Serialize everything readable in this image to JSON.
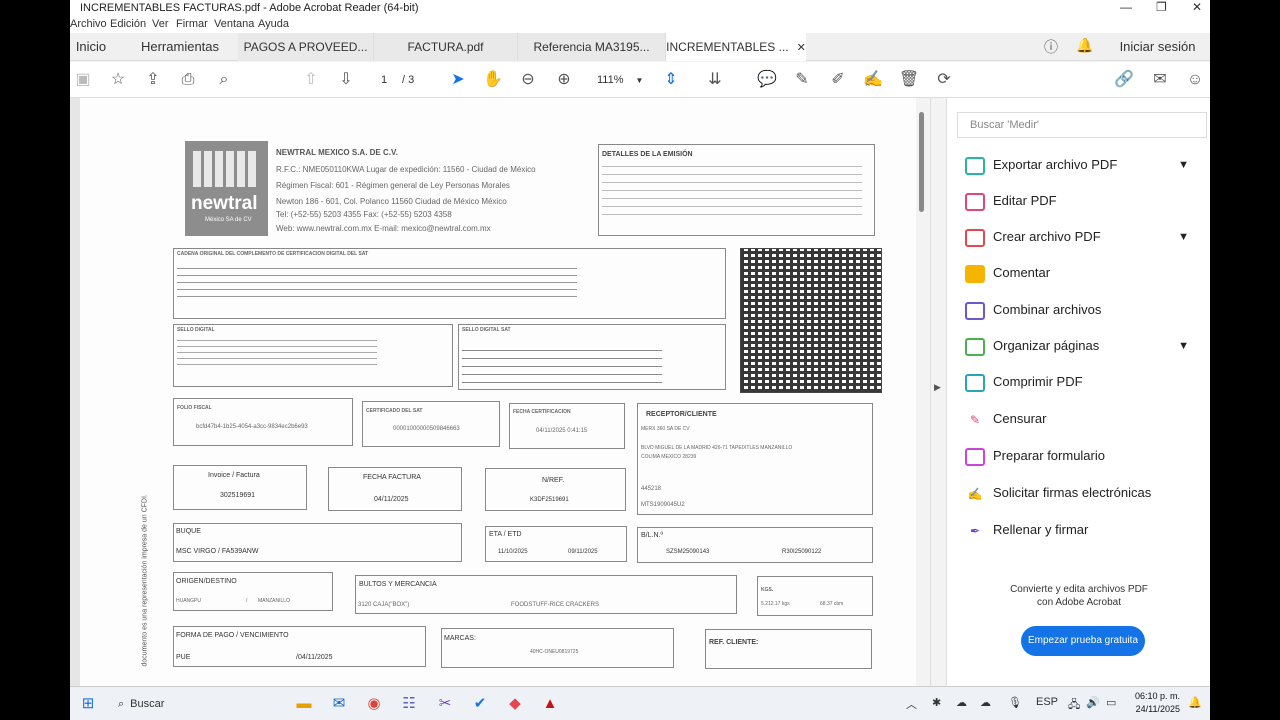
{
  "window": {
    "title": "INCREMENTABLES FACTURAS.pdf - Adobe Acrobat Reader (64-bit)"
  },
  "menu": [
    "Archivo",
    "Edición",
    "Ver",
    "Firmar",
    "Ventana",
    "Ayuda"
  ],
  "tabs": {
    "home": "Inicio",
    "tools": "Herramientas",
    "docs": [
      "PAGOS A PROVEED...",
      "FACTURA.pdf",
      "Referencia MA3195...",
      "INCREMENTABLES ..."
    ],
    "signin": "Iniciar sesión"
  },
  "toolbar": {
    "page_current": "1",
    "page_total": "/ 3",
    "zoom": "111%"
  },
  "invoice": {
    "company": "NEWTRAL MEXICO S.A. DE C.V.",
    "rfc": "R.F.C.: NME050110KWA   Lugar de expedición: 11560 - Ciudad de México",
    "regimen": "Régimen Fiscal: 601 - Régimen general de Ley Personas Morales",
    "address": "Newton 186 - 601, Col. Polanco 11560 Ciudad de México   México",
    "phone": "Tel: (+52-55) 5203 4355 Fax: (+52-55) 5203 4358",
    "web": "Web: www.newtral.com.mx      E-mail: mexico@newtral.com.mx",
    "logo_text": "newtral",
    "logo_sub": "México SA de CV",
    "detalles_title": "DETALLES DE LA EMISIÓN",
    "cadena_title": "CADENA ORIGINAL DEL COMPLEMENTO DE CERTIFICACION DIGITAL DEL SAT",
    "sello_digital": "SELLO DIGITAL",
    "sello_sat": "SELLO DIGITAL SAT",
    "folio_fiscal_lbl": "FOLIO FISCAL",
    "folio_fiscal": "bcfd47b4-1b25-4054-a3cc-9834ec2b6e93",
    "cert_sat_lbl": "CERTIFICADO DEL SAT",
    "cert_sat": "00001000000509846663",
    "fecha_cert_lbl": "FECHA CERTIFICACION",
    "fecha_cert": "04/11/2025 0:41:15",
    "receptor_lbl": "RECEPTOR/CLIENTE",
    "receptor_name": "MERX 360 SA DE CV",
    "receptor_addr": "BLVD MIGUEL DE LA MADRID 426-71 TAPEIXTLES MANZANILLO",
    "receptor_city": "COLIMA MEXICO 28239",
    "receptor_num": "445218",
    "receptor_rfc": "MTS1909045U2",
    "invoice_lbl": "Invoice / Factura",
    "invoice_no": "302519691",
    "fecha_fact_lbl": "FECHA FACTURA",
    "fecha_fact": "04/11/2025",
    "nref_lbl": "N/REF.",
    "nref": "K3DF2519691",
    "buque_lbl": "BUQUE",
    "buque": "MSC VIRGO / FA539ANW",
    "eta_lbl": "ETA / ETD",
    "eta": "11/10/2025",
    "etd": "09/11/2025",
    "bl_lbl": "B/L.N.º",
    "bl1": "SZSM25090143",
    "bl2": "R30I25090122",
    "origen_lbl": "ORIGEN/DESTINO",
    "origen": "HUANGPU",
    "destino": "MANZANILLO",
    "bultos_lbl": "BULTOS Y MERCANCIA",
    "bultos": "3120 CAJA(\"BOX\")",
    "mercancia": "FOODSTUFF-RICE CRACKERS",
    "kgs_lbl": "KGS.",
    "kgs": "5.212.17 kgs",
    "cbm": "68.37 cbm",
    "pago_lbl": "FORMA DE PAGO / VENCIMIENTO",
    "pago": "PUE",
    "venc": "04/11/2025",
    "marcas_lbl": "MARCAS:",
    "marcas": "40HC-ONEU0819725",
    "refcli_lbl": "REF. CLIENTE:",
    "side_text": "documento es una representación impresa de un CFDI."
  },
  "panel": {
    "search_placeholder": "Buscar 'Medir'",
    "tools": [
      {
        "label": "Exportar archivo PDF",
        "color": "#26b5a0"
      },
      {
        "label": "Editar PDF",
        "color": "#e0457b"
      },
      {
        "label": "Crear archivo PDF",
        "color": "#e34850"
      },
      {
        "label": "Comentar",
        "color": "#f4b400"
      },
      {
        "label": "Combinar archivos",
        "color": "#6e56cf"
      },
      {
        "label": "Organizar páginas",
        "color": "#4caf50"
      },
      {
        "label": "Comprimir PDF",
        "color": "#26a6b5"
      },
      {
        "label": "Censurar",
        "color": "#e0457b"
      },
      {
        "label": "Preparar formulario",
        "color": "#c846d8"
      },
      {
        "label": "Solicitar firmas electrónicas",
        "color": "#a744c9"
      },
      {
        "label": "Rellenar y firmar",
        "color": "#7b3fc9"
      }
    ],
    "promo_line1": "Convierte y edita archivos PDF",
    "promo_line2": "con Adobe Acrobat",
    "trial_button": "Empezar prueba gratuita"
  },
  "taskbar": {
    "search": "Buscar",
    "lang": "ESP",
    "time": "06:10 p. m.",
    "date": "24/11/2025"
  }
}
